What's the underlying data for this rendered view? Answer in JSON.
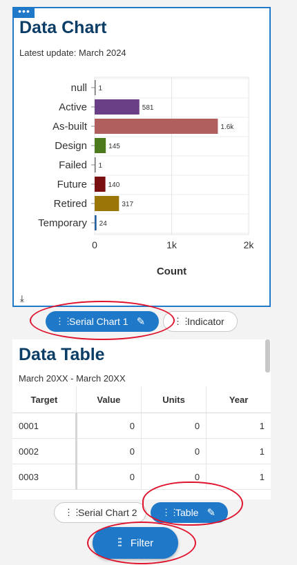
{
  "chart_panel": {
    "title": "Data Chart",
    "subtitle": "Latest update: March 2024"
  },
  "chart_data": {
    "type": "bar",
    "orientation": "horizontal",
    "categories": [
      "null",
      "Active",
      "As-built",
      "Design",
      "Failed",
      "Future",
      "Retired",
      "Temporary"
    ],
    "values": [
      1,
      581,
      1600,
      145,
      1,
      140,
      317,
      24
    ],
    "value_labels": [
      "1",
      "581",
      "1.6k",
      "145",
      "1",
      "140",
      "317",
      "24"
    ],
    "colors": [
      "#6e6e6e",
      "#6b3f86",
      "#b05e5e",
      "#4e7a1e",
      "#6e6e6e",
      "#7a0f12",
      "#9a7608",
      "#2a5f9e"
    ],
    "xlabel": "Count",
    "xlim": [
      0,
      2000
    ],
    "xticks": [
      0,
      1000,
      2000
    ],
    "xtick_labels": [
      "0",
      "1k",
      "2k"
    ],
    "grid": true
  },
  "pill_bar_top": {
    "serial_chart_1": "Serial Chart 1",
    "indicator": "Indicator"
  },
  "table_panel": {
    "title": "Data Table",
    "subtitle": "March 20XX - March 20XX",
    "columns": [
      "Target",
      "Value",
      "Units",
      "Year"
    ],
    "rows": [
      [
        "0001",
        "0",
        "0",
        "1"
      ],
      [
        "0002",
        "0",
        "0",
        "1"
      ],
      [
        "0003",
        "0",
        "0",
        "1"
      ]
    ]
  },
  "pill_bar_bottom": {
    "serial_chart_2": "Serial Chart 2",
    "table": "Table"
  },
  "filter": {
    "label": "Filter"
  },
  "accent_color": "#1f78c8",
  "annotation_color": "#e0132d"
}
